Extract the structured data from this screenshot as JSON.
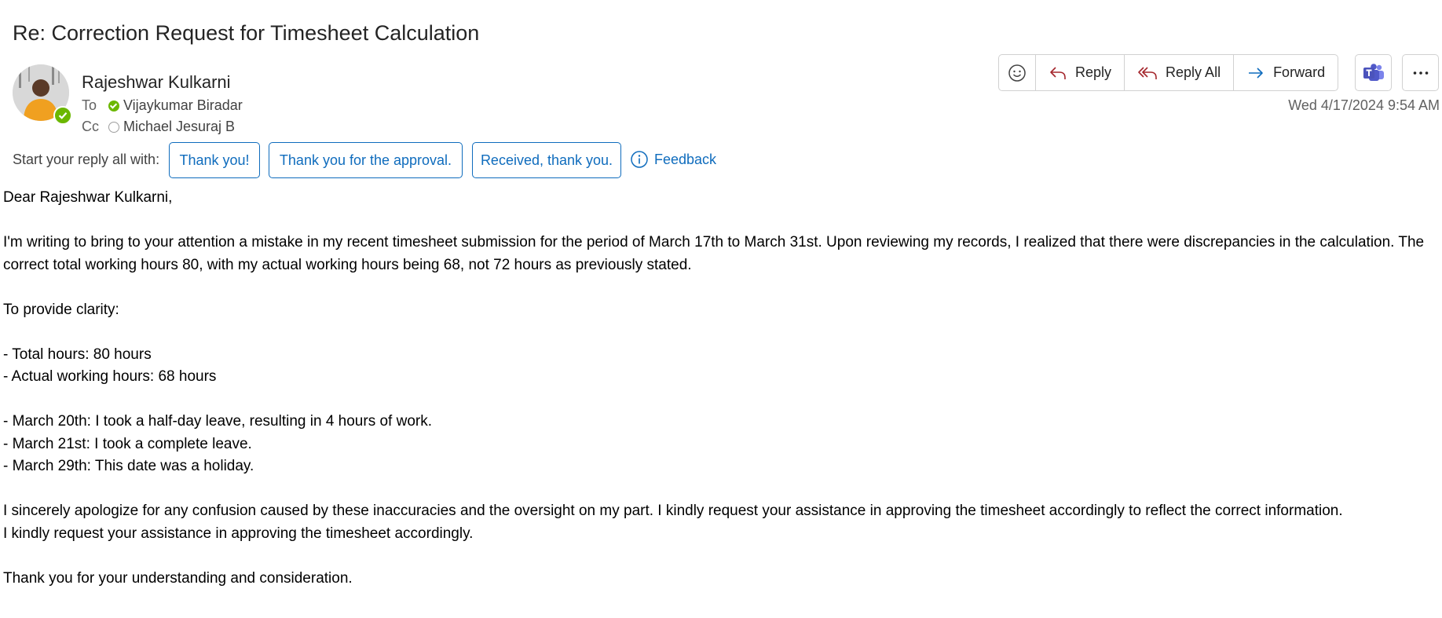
{
  "email": {
    "subject": "Re: Correction Request for Timesheet Calculation",
    "sender": "Rajeshwar Kulkarni",
    "to_label": "To",
    "to_name": "Vijaykumar Biradar",
    "cc_label": "Cc",
    "cc_name": "Michael Jesuraj B",
    "timestamp": "Wed 4/17/2024 9:54 AM"
  },
  "actions": {
    "emoji_icon": "emoji-smile-icon",
    "reply": "Reply",
    "reply_all": "Reply All",
    "forward": "Forward",
    "teams_icon": "teams-icon",
    "more_icon": "more-ellipsis-icon"
  },
  "suggestions": {
    "label": "Start your reply all with:",
    "items": [
      "Thank you!",
      "Thank you for the approval.",
      "Received, thank you."
    ],
    "feedback": "Feedback"
  },
  "body": [
    "Dear Rajeshwar Kulkarni,",
    "",
    "I'm writing to bring to your attention a mistake in my recent timesheet submission for the period of March 17th to March 31st. Upon reviewing my records, I realized that there were discrepancies in the calculation. The correct total working hours 80, with my actual working hours being 68, not 72 hours as previously stated.",
    "",
    "To provide clarity:",
    "",
    "- Total hours: 80 hours",
    "- Actual working hours: 68 hours",
    "",
    "- March 20th: I took a half-day leave, resulting in 4 hours of work.",
    "- March 21st: I took a complete leave.",
    "- March 29th: This date was a holiday.",
    "",
    "I sincerely apologize for any confusion caused by these inaccuracies and the oversight on my part. I kindly request your assistance in approving the timesheet accordingly to reflect the correct information.",
    "I kindly request your assistance in approving the timesheet accordingly.",
    "",
    "Thank you for your understanding and consideration."
  ],
  "colors": {
    "accent": "#0f6cbd",
    "reply_icon": "#a4262c",
    "presence_available": "#6bb700",
    "teams": "#5059c9"
  }
}
